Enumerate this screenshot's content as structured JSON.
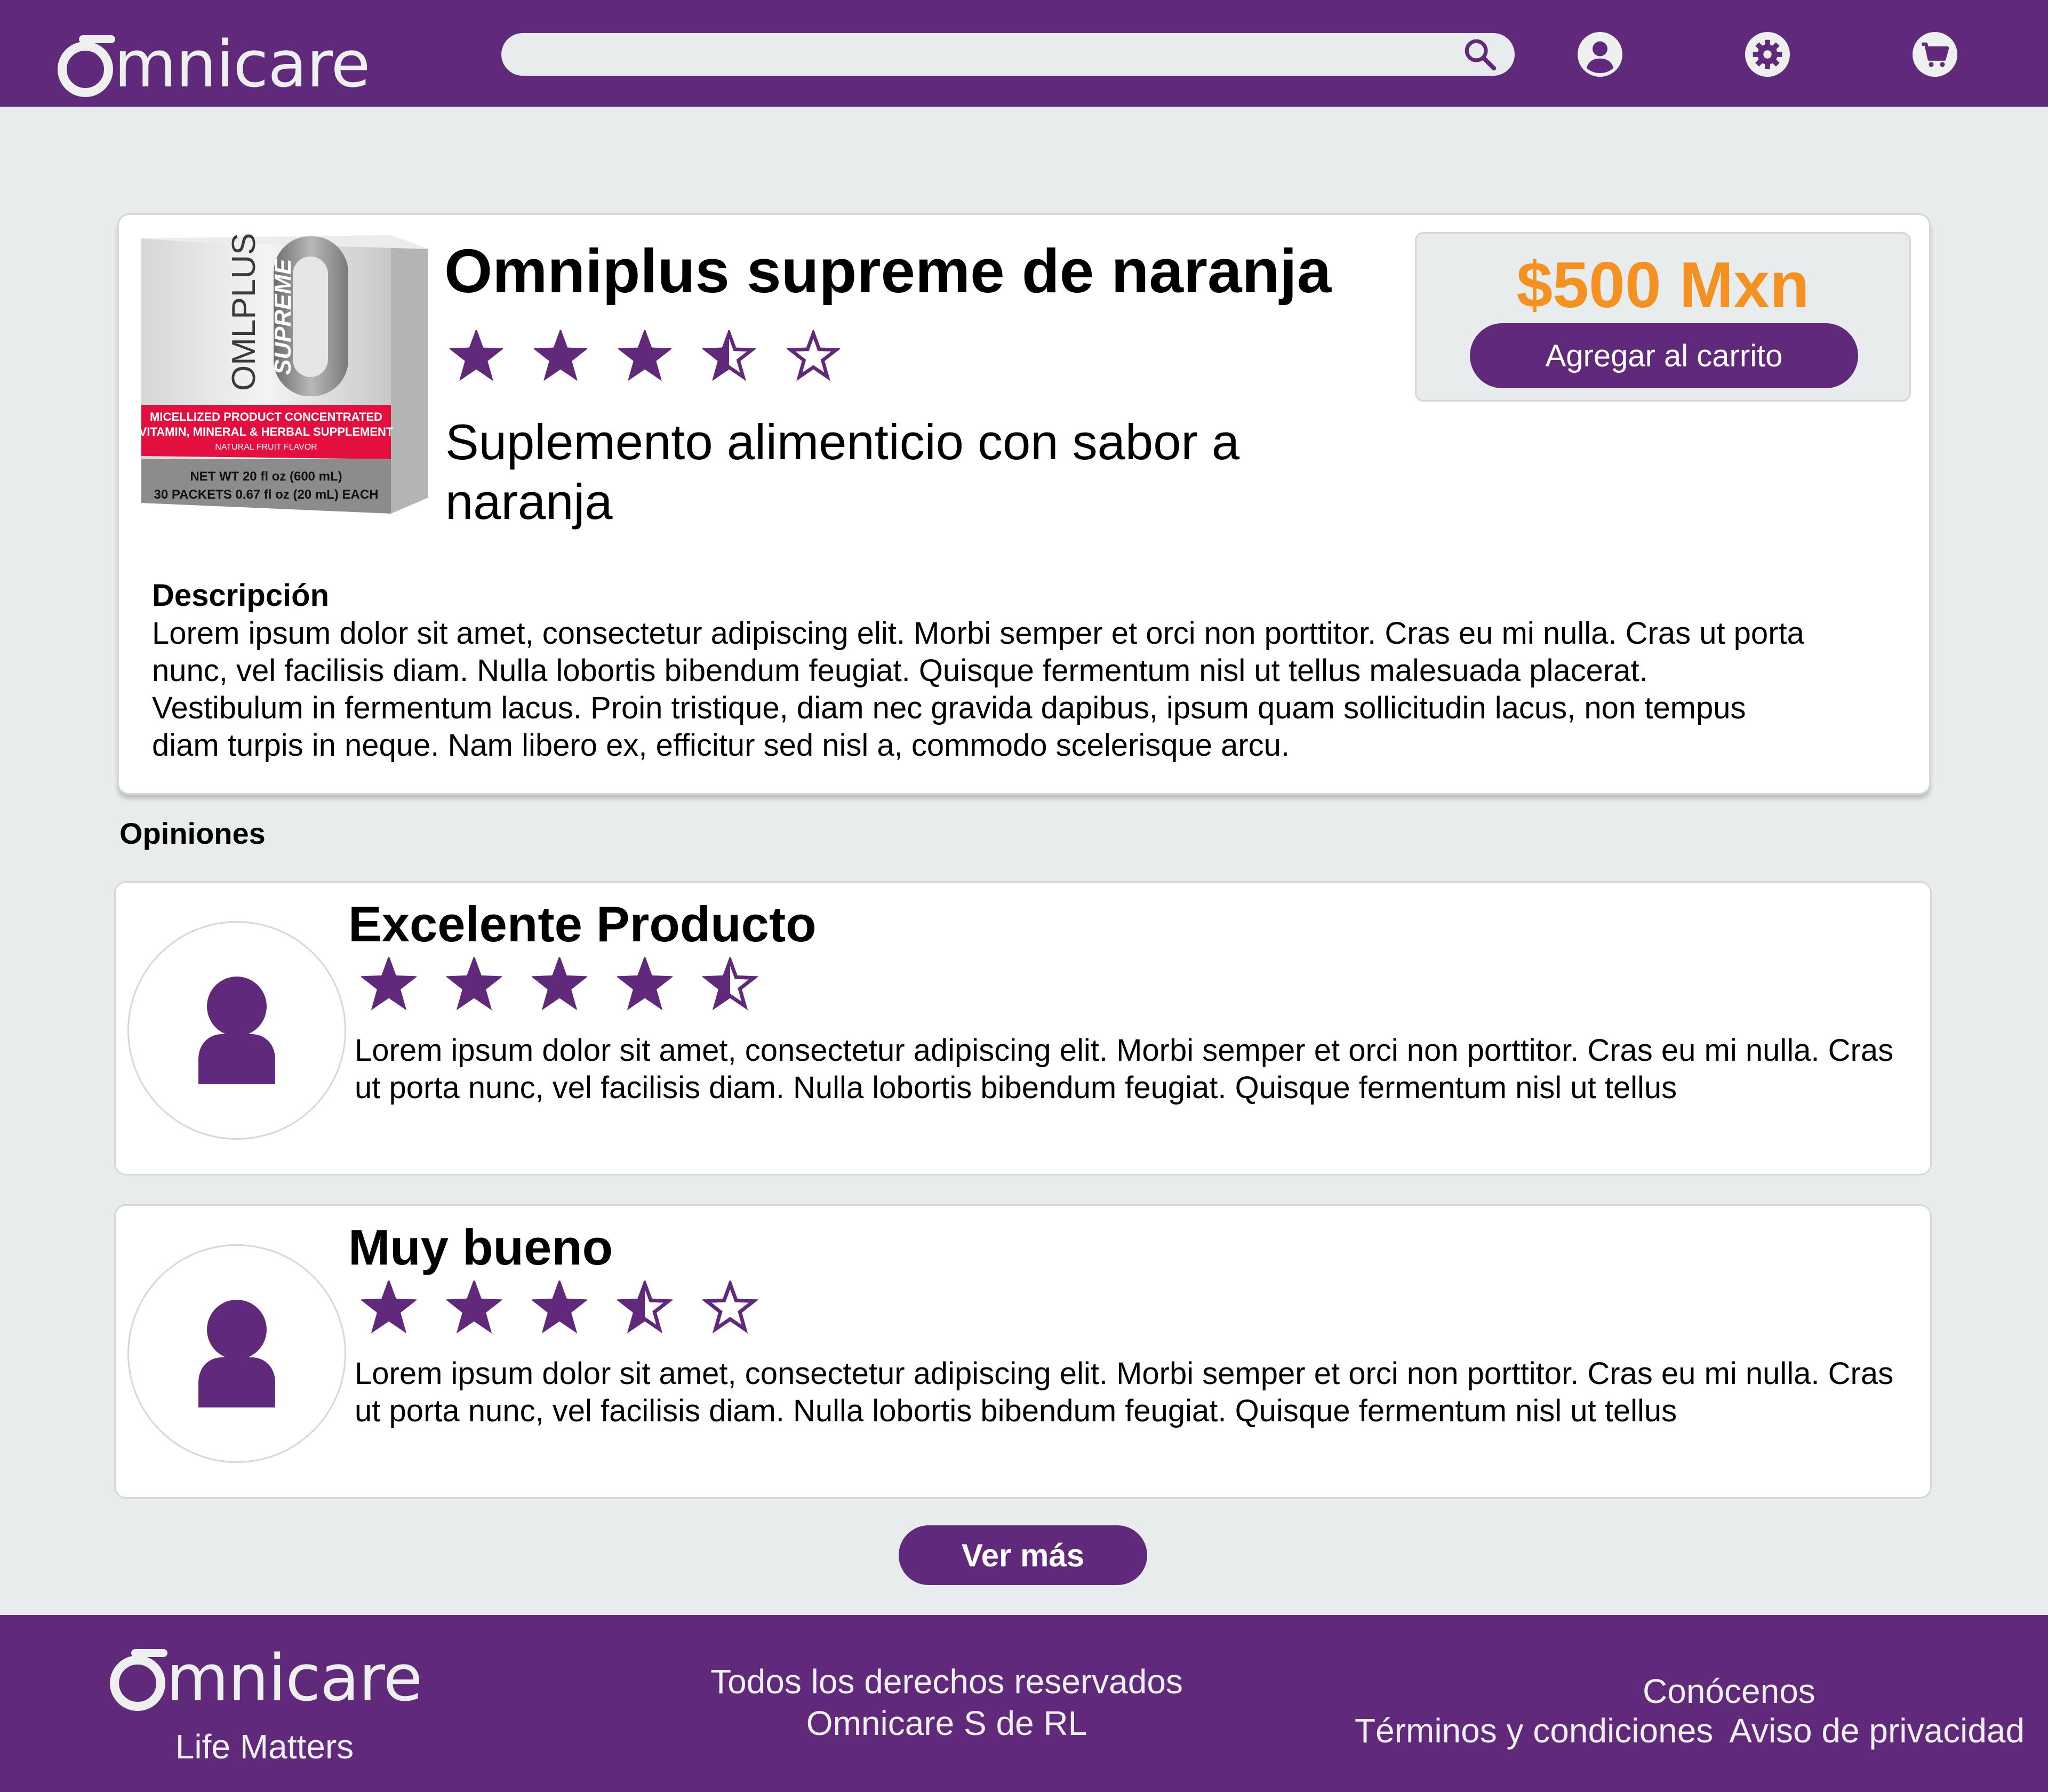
{
  "header": {
    "logo_text": "mnicare",
    "search": {
      "value": "",
      "placeholder": ""
    },
    "icons": [
      "search-icon",
      "user-icon",
      "gear-icon",
      "cart-icon"
    ]
  },
  "product": {
    "title": "Omniplus supreme de naranja",
    "rating": 3.5,
    "subtitle": "Suplemento alimenticio con sabor a naranja",
    "price": "$500 Mxn",
    "cart_button": "Agregar al carrito",
    "description_title": "Descripción",
    "description": "Lorem ipsum dolor sit amet, consectetur adipiscing elit. Morbi semper et orci non porttitor. Cras eu mi nulla. Cras ut porta nunc, vel facilisis diam. Nulla lobortis bibendum feugiat. Quisque fermentum nisl ut tellus malesuada placerat. Vestibulum in fermentum lacus. Proin tristique, diam nec gravida dapibus, ipsum quam sollicitudin lacus, non tempus diam turpis in neque. Nam libero ex, efficitur sed nisl a, commodo scelerisque arcu.",
    "image": {
      "brand": "OMLPLUS",
      "name": "SUPREME",
      "band_line1": "MICELLIZED PRODUCT CONCENTRATED",
      "band_line2": "VITAMIN, MINERAL & HERBAL SUPPLEMENT",
      "band_line3": "NATURAL FRUIT FLAVOR",
      "net_line1": "NET WT 20 fl oz (600 mL)",
      "net_line2": "30 PACKETS 0.67 fl oz (20 mL) EACH"
    }
  },
  "reviews_section": {
    "title": "Opiniones",
    "reviews": [
      {
        "title": "Excelente Producto",
        "rating": 4.5,
        "text": "Lorem ipsum dolor sit amet, consectetur adipiscing elit. Morbi semper et orci non porttitor. Cras eu mi nulla.  Cras ut porta nunc, vel facilisis diam. Nulla lobortis bibendum feugiat. Quisque fermentum nisl ut tellus"
      },
      {
        "title": "Muy bueno",
        "rating": 3.5,
        "text": "Lorem ipsum dolor sit amet, consectetur adipiscing elit. Morbi semper et orci non porttitor. Cras eu mi nulla.  Cras ut porta nunc, vel facilisis diam. Nulla lobortis bibendum feugiat. Quisque fermentum nisl ut tellus"
      }
    ],
    "more_button": "Ver más"
  },
  "footer": {
    "logo_text": "mnicare",
    "tagline": "Life Matters",
    "rights_line1": "Todos los derechos reservados",
    "rights_line2": "Omnicare S de RL",
    "link_about": "Conócenos",
    "link_terms": "Términos y condiciones",
    "link_privacy": "Aviso de privacidad"
  },
  "colors": {
    "brand_purple": "#61297a",
    "price_orange": "#f39223",
    "background": "#e8ecec"
  }
}
